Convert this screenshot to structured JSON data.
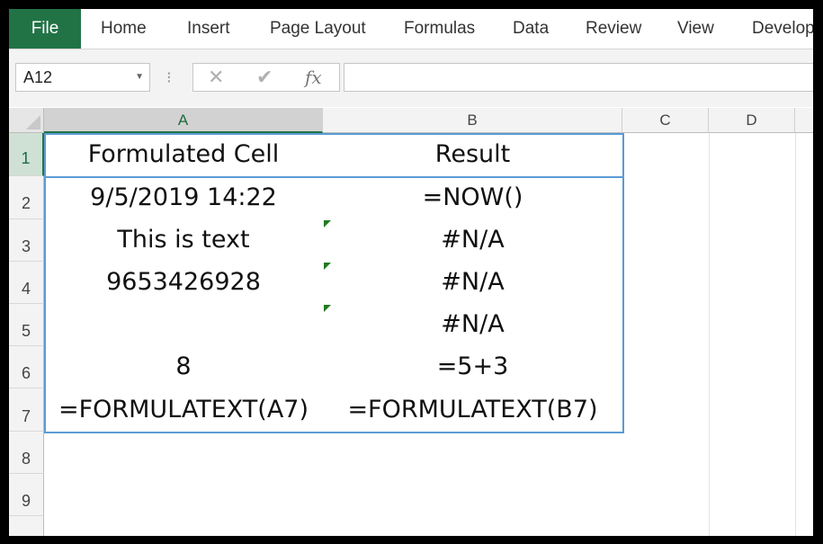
{
  "ribbon": {
    "tabs": [
      "File",
      "Home",
      "Insert",
      "Page Layout",
      "Formulas",
      "Data",
      "Review",
      "View",
      "Develop"
    ]
  },
  "formula_bar": {
    "name_box": "A12",
    "cancel_icon": "✕",
    "enter_icon": "✔",
    "fx_label": "fx",
    "formula_value": ""
  },
  "grid": {
    "columns": [
      "A",
      "B",
      "C",
      "D"
    ],
    "rows": [
      "1",
      "2",
      "3",
      "4",
      "5",
      "6",
      "7",
      "8",
      "9"
    ],
    "header": [
      "Formulated Cell",
      "Result"
    ],
    "data": [
      [
        "9/5/2019 14:22",
        "=NOW()"
      ],
      [
        "This is text",
        "#N/A"
      ],
      [
        "9653426928",
        "#N/A"
      ],
      [
        "",
        "#N/A"
      ],
      [
        "8",
        "=5+3"
      ],
      [
        "=FORMULATEXT(A7)",
        "=FORMULATEXT(B7)"
      ]
    ]
  },
  "colors": {
    "excel_green": "#217346",
    "table_border": "#5b9bd5",
    "error_indicator": "#1f7a1f"
  }
}
